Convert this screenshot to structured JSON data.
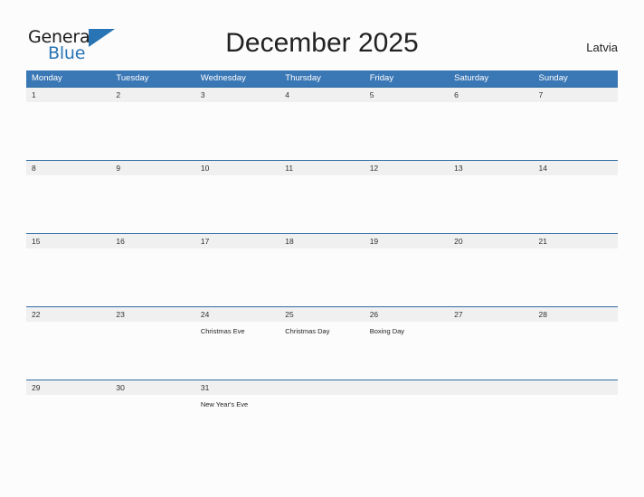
{
  "brand": {
    "name_part1": "General",
    "name_part2": "Blue",
    "triangle_icon": "triangle-icon",
    "accent_color": "#2874b4"
  },
  "header": {
    "title": "December 2025",
    "country": "Latvia"
  },
  "calendar": {
    "header_bg": "#3a77b5",
    "date_band_bg": "#f0f0f0",
    "rule_color": "#2e6ca4",
    "weekdays": [
      "Monday",
      "Tuesday",
      "Wednesday",
      "Thursday",
      "Friday",
      "Saturday",
      "Sunday"
    ],
    "weeks": [
      {
        "days": [
          {
            "date": "1",
            "event": ""
          },
          {
            "date": "2",
            "event": ""
          },
          {
            "date": "3",
            "event": ""
          },
          {
            "date": "4",
            "event": ""
          },
          {
            "date": "5",
            "event": ""
          },
          {
            "date": "6",
            "event": ""
          },
          {
            "date": "7",
            "event": ""
          }
        ]
      },
      {
        "days": [
          {
            "date": "8",
            "event": ""
          },
          {
            "date": "9",
            "event": ""
          },
          {
            "date": "10",
            "event": ""
          },
          {
            "date": "11",
            "event": ""
          },
          {
            "date": "12",
            "event": ""
          },
          {
            "date": "13",
            "event": ""
          },
          {
            "date": "14",
            "event": ""
          }
        ]
      },
      {
        "days": [
          {
            "date": "15",
            "event": ""
          },
          {
            "date": "16",
            "event": ""
          },
          {
            "date": "17",
            "event": ""
          },
          {
            "date": "18",
            "event": ""
          },
          {
            "date": "19",
            "event": ""
          },
          {
            "date": "20",
            "event": ""
          },
          {
            "date": "21",
            "event": ""
          }
        ]
      },
      {
        "days": [
          {
            "date": "22",
            "event": ""
          },
          {
            "date": "23",
            "event": ""
          },
          {
            "date": "24",
            "event": "Christmas Eve"
          },
          {
            "date": "25",
            "event": "Christmas Day"
          },
          {
            "date": "26",
            "event": "Boxing Day"
          },
          {
            "date": "27",
            "event": ""
          },
          {
            "date": "28",
            "event": ""
          }
        ]
      },
      {
        "days": [
          {
            "date": "29",
            "event": ""
          },
          {
            "date": "30",
            "event": ""
          },
          {
            "date": "31",
            "event": "New Year's Eve"
          },
          {
            "date": "",
            "event": ""
          },
          {
            "date": "",
            "event": ""
          },
          {
            "date": "",
            "event": ""
          },
          {
            "date": "",
            "event": ""
          }
        ]
      }
    ]
  }
}
